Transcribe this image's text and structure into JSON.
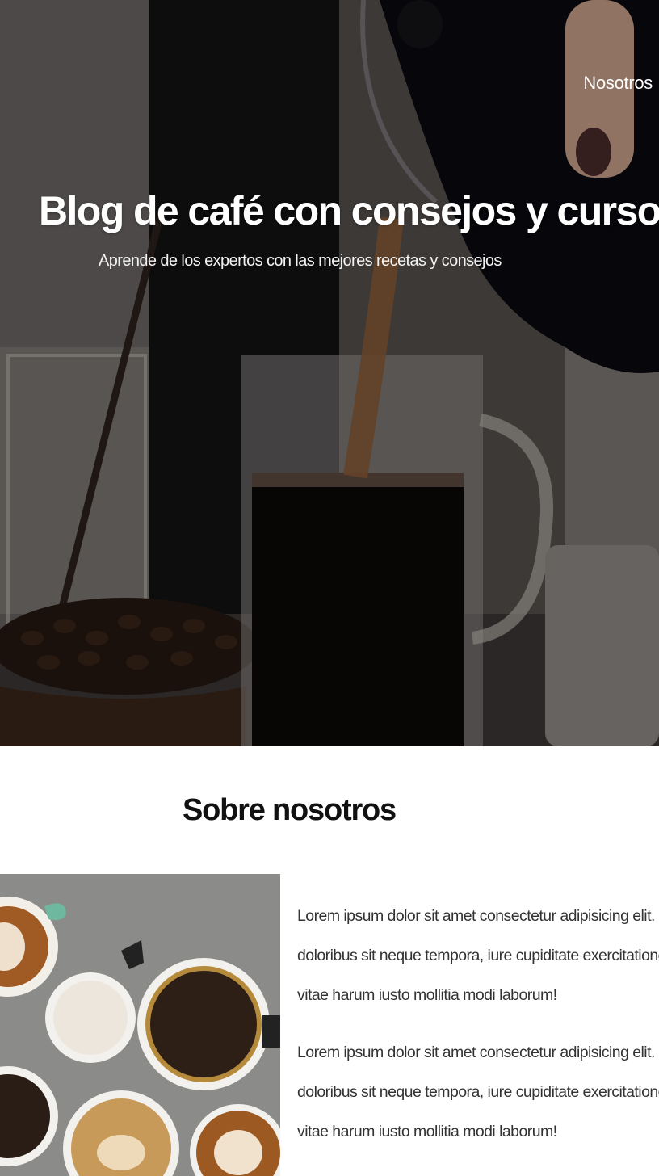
{
  "nav": {
    "link_label": "Nosotros"
  },
  "hero": {
    "title": "Blog de café con consejos y cursos",
    "subtitle": "Aprende de los expertos con las mejores recetas y consejos"
  },
  "about": {
    "title": "Sobre nosotros",
    "paragraphs": [
      "Lorem ipsum dolor sit amet consectetur adipisicing elit. Pariatur quos quia doloribus sit neque tempora, iure cupiditate exercitationem quae placeat vitae harum iusto mollitia modi laborum!",
      "Lorem ipsum dolor sit amet consectetur adipisicing elit. Pariatur quos quia doloribus sit neque tempora, iure cupiditate exercitationem quae placeat vitae harum iusto mollitia modi laborum!"
    ]
  },
  "colors": {
    "hero_overlay": "#000000",
    "text_dark": "#111111",
    "text_body": "#333333",
    "text_light": "#ffffff"
  }
}
